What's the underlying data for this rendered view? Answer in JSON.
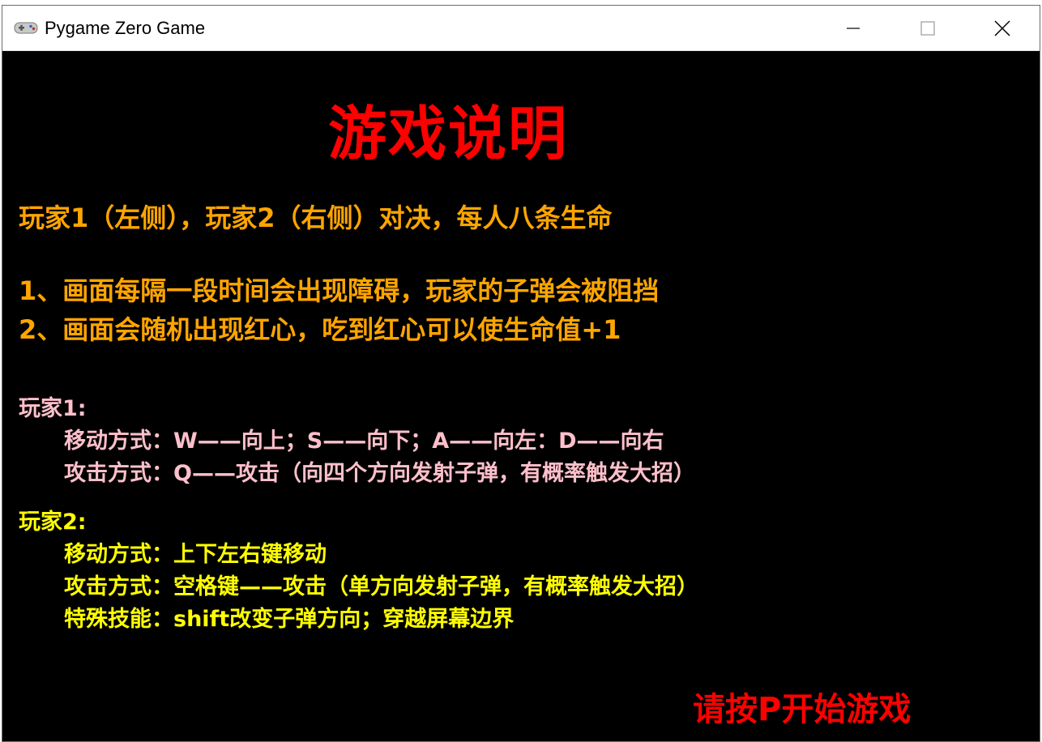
{
  "window": {
    "title": "Pygame Zero Game",
    "app_icon": "gamepad-icon",
    "controls": [
      "minimize-icon",
      "maximize-icon",
      "close-icon"
    ]
  },
  "colors": {
    "background": "#000000",
    "title": "#ff0000",
    "intro": "#ffa500",
    "player1": "#ffc0cb",
    "player2": "#ffff00",
    "start_hint": "#ff0000"
  },
  "game": {
    "heading": "游戏说明",
    "intro_line": "玩家1（左侧），玩家2（右侧）对决，每人八条生命",
    "rules": [
      "1、画面每隔一段时间会出现障碍，玩家的子弹会被阻挡",
      "2、画面会随机出现红心，吃到红心可以使生命值+1"
    ],
    "player1": {
      "label": "玩家1:",
      "move": "移动方式：W——向上；S——向下；A——向左：D——向右",
      "attack": "攻击方式：Q——攻击（向四个方向发射子弹，有概率触发大招）"
    },
    "player2": {
      "label": "玩家2:",
      "move": "移动方式：上下左右键移动",
      "attack": "攻击方式：空格键——攻击（单方向发射子弹，有概率触发大招）",
      "special": "特殊技能：shift改变子弹方向；穿越屏幕边界"
    },
    "start_hint": "请按P开始游戏"
  }
}
